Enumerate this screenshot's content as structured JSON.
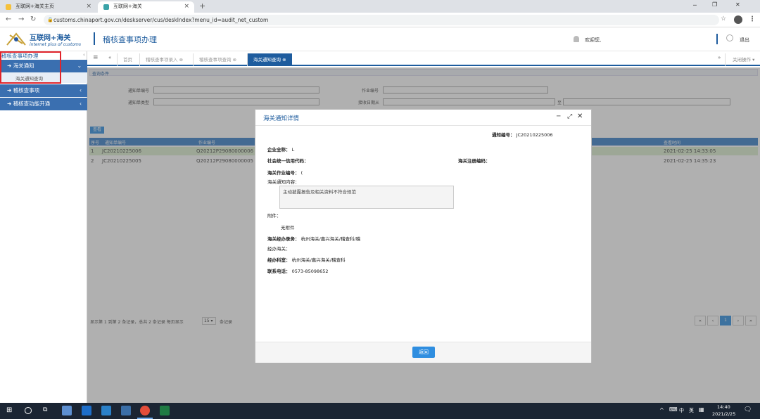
{
  "browser": {
    "tabs": [
      {
        "title": "互联网+海关主页",
        "active": false
      },
      {
        "title": "互联网+海关",
        "active": true
      }
    ],
    "new_tab": "+",
    "url": "customs.chinaport.gov.cn/deskserver/cus/deskIndex?menu_id=audit_net_custom",
    "window_min": "─",
    "window_restore": "❐",
    "window_close": "✕"
  },
  "header": {
    "logo_title": "互联网+海关",
    "logo_sub": "internet plus of customs",
    "page_title": "稽核查事项办理",
    "welcome": "欢迎您,",
    "logout": "退出"
  },
  "sidebar": {
    "section_title": "稽核查事项办理",
    "items": [
      {
        "label": "海关通知",
        "expanded": true,
        "children": [
          "海关通知查询"
        ]
      },
      {
        "label": "稽核查事项"
      },
      {
        "label": "稽核查功能开通"
      }
    ]
  },
  "tabs": {
    "items": [
      "首页",
      "稽核查事项录入",
      "稽核查事项查询",
      "海关通知查询"
    ],
    "close_ops": "关闭操作"
  },
  "search": {
    "header": "查询条件",
    "notice_no_label": "通知单编号",
    "job_no_label": "作业编号",
    "notice_type_label": "通知单类型",
    "recv_date_label": "接收日期从",
    "to_label": "至"
  },
  "table": {
    "query_button": "查看",
    "headers": [
      "序号",
      "通知单编号",
      "作业编号",
      "",
      "查看时间"
    ],
    "rows": [
      {
        "idx": "1",
        "notice_no": "JC20210225006",
        "job_no": "Q20212P29080000006",
        "time": "2021-02-25 14:33:05"
      },
      {
        "idx": "2",
        "notice_no": "JC20210225005",
        "job_no": "Q20212P29080000005",
        "time": "2021-02-25 14:35:23"
      }
    ],
    "pager_text": "显示第 1 到第 2 条记录，总共 2 条记录 每页显示",
    "page_size": "15",
    "pager_suffix": "条记录",
    "current_page": "1"
  },
  "modal": {
    "title": "海关通知详情",
    "notice_no_label": "通知编号：",
    "notice_no": "JC20210225006",
    "company_label": "企业全称：",
    "company": "L",
    "credit_code_label": "社会统一信用代码：",
    "customs_reg_label": "海关注册编码：",
    "job_no_label": "海关作业编号：",
    "job_no": "(",
    "content_label": "海关通知内容：",
    "content": "主动披露报告及相关资料不符合规范",
    "attachment_label": "附件：",
    "attachment": "无附件",
    "handling_label": "海关经办录务：",
    "handling": "杭州海关/嘉兴海关/稽查科/稽",
    "office_label": "经办海关：",
    "dept_label": "经办科室：",
    "dept": "杭州海关/嘉兴海关/稽查科",
    "phone_label": "联系电话：",
    "phone": "0573-85098652",
    "return_button": "返回"
  },
  "taskbar": {
    "ime": "中",
    "lang": "英",
    "time": "14:40",
    "date": "2021/2/25"
  },
  "colors": {
    "primary": "#1e5c9e",
    "sidebar_blue": "#3a6fb0",
    "highlight_red": "#e0242b",
    "button_blue": "#2f8ee0"
  }
}
